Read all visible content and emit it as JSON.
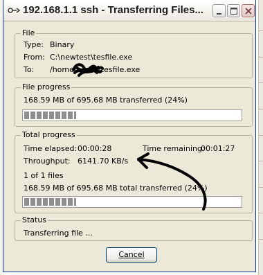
{
  "window": {
    "title": "192.168.1.1 ssh - Transferring Files...",
    "icon": "ssh-transfer-icon"
  },
  "file_group": {
    "label": "File",
    "type_label": "Type:",
    "type_value": "Binary",
    "from_label": "From:",
    "from_value": "C:\\newtest\\tesfile.exe",
    "to_label": "To:",
    "to_value_prefix": "/home/",
    "to_value_suffix": "/tesfile.exe"
  },
  "file_progress": {
    "label": "File progress",
    "text": "168.59 MB of 695.68 MB transferred (24%)",
    "percent": 24
  },
  "total_progress": {
    "label": "Total progress",
    "time_elapsed_label": "Time elapsed:",
    "time_elapsed_value": "00:00:28",
    "time_remaining_label": "Time remaining:",
    "time_remaining_value": "00:01:27",
    "throughput_label": "Throughput:",
    "throughput_value": "6141.70 KB/s",
    "files_text": "1 of 1 files",
    "total_text": "168.59 MB of 695.68 MB total transferred (24%)",
    "percent": 24
  },
  "status": {
    "label": "Status",
    "text": "Transferring file ..."
  },
  "buttons": {
    "cancel_label": "Cancel"
  },
  "colors": {
    "dialog_background": "#ece9d8",
    "progress_block": "#8e8e8e",
    "annotation": "#000000"
  }
}
